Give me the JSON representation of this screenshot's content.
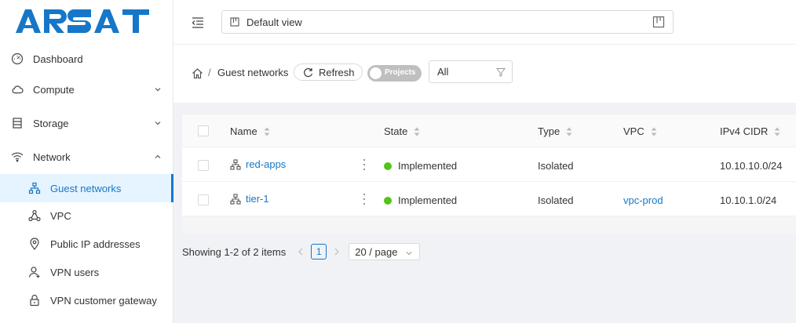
{
  "brand": {
    "name": "ARSAT",
    "color": "#1677c9"
  },
  "sidebar": {
    "items": [
      {
        "label": "Dashboard",
        "icon": "dashboard-icon"
      },
      {
        "label": "Compute",
        "icon": "cloud-icon",
        "expandable": true,
        "expanded": false
      },
      {
        "label": "Storage",
        "icon": "storage-icon",
        "expandable": true,
        "expanded": false
      },
      {
        "label": "Network",
        "icon": "wifi-icon",
        "expandable": true,
        "expanded": true
      }
    ],
    "network_children": [
      {
        "label": "Guest networks",
        "icon": "network-tree-icon",
        "active": true
      },
      {
        "label": "VPC",
        "icon": "vpc-icon"
      },
      {
        "label": "Public IP addresses",
        "icon": "location-pin-icon"
      },
      {
        "label": "VPN users",
        "icon": "user-icon"
      },
      {
        "label": "VPN customer gateway",
        "icon": "lock-icon"
      }
    ]
  },
  "header": {
    "view_selector": {
      "value": "Default view"
    }
  },
  "breadcrumb": {
    "separator": "/",
    "current": "Guest networks"
  },
  "toolbar": {
    "refresh_label": "Refresh",
    "toggle_label": "Projects",
    "toggle_on": false,
    "filter_value": "All"
  },
  "table": {
    "columns": [
      "Name",
      "State",
      "Type",
      "VPC",
      "IPv4 CIDR"
    ],
    "rows": [
      {
        "name": "red-apps",
        "state": "Implemented",
        "type": "Isolated",
        "vpc": "",
        "cidr": "10.10.10.0/24"
      },
      {
        "name": "tier-1",
        "state": "Implemented",
        "type": "Isolated",
        "vpc": "vpc-prod",
        "cidr": "10.10.1.0/24"
      }
    ],
    "state_color": "#52c41a"
  },
  "pagination": {
    "total_text": "Showing 1-2 of 2 items",
    "current_page": "1",
    "page_size": "20 / page"
  }
}
